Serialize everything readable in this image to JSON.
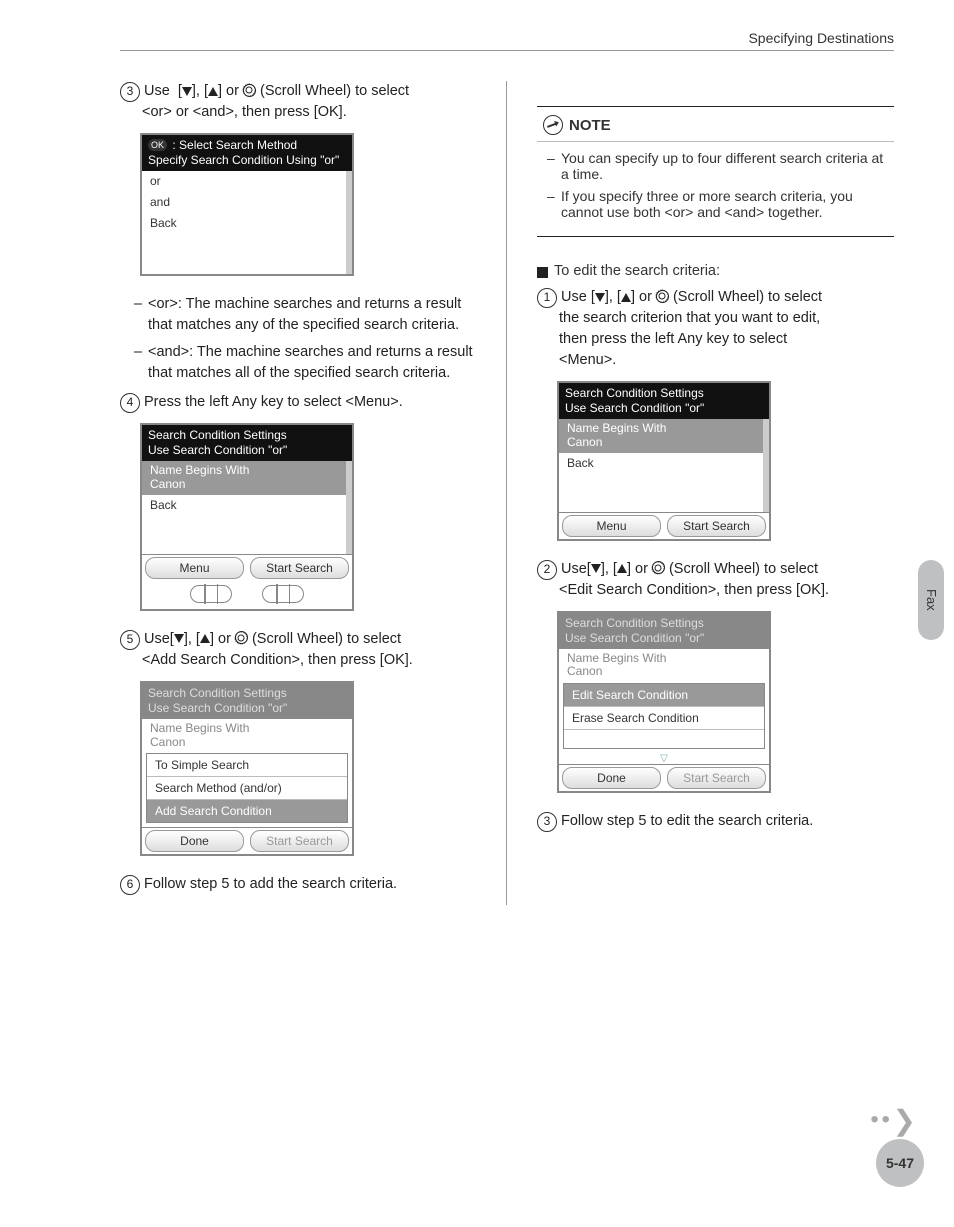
{
  "header": {
    "title": "Specifying Destinations"
  },
  "side_tab": "Fax",
  "page_number": "5-47",
  "left": {
    "step3": {
      "num": "3",
      "line1": "Use  [▼], [▲] or ◎ (Scroll Wheel) to select",
      "line2": "<or> or <and>, then press [OK]."
    },
    "device1": {
      "title_prefix": "OK",
      "title1": " : Select Search Method",
      "title2": "Specify Search Condition Using \"or\"",
      "rows": [
        "or",
        "and",
        "Back"
      ]
    },
    "dash": {
      "or": "<or>: The machine searches and returns a result that matches any of the specified search criteria.",
      "and": "<and>: The machine searches and returns a result that matches all of the specified search criteria."
    },
    "step4": {
      "num": "4",
      "text": "Press the left Any key to select <Menu>."
    },
    "device2": {
      "title1": "Search Condition Settings",
      "title2": "Use Search Condition \"or\"",
      "two_line": "Name Begins With\nCanon",
      "back": "Back",
      "btn_left": "Menu",
      "btn_right": "Start Search"
    },
    "step5": {
      "num": "5",
      "line1": "Use[▼], [▲] or ◎ (Scroll Wheel) to select",
      "line2": "<Add Search Condition>, then press [OK]."
    },
    "device3": {
      "title1": "Search Condition Settings",
      "title2": "Use Search Condition \"or\"",
      "two_line": "Name Begins With\nCanon",
      "rows": [
        "To Simple Search",
        "Search Method (and/or)",
        "Add Search Condition"
      ],
      "btn_left": "Done",
      "btn_right": "Start Search"
    },
    "step6": {
      "num": "6",
      "text": "Follow step 5 to add the search criteria."
    }
  },
  "right": {
    "note": {
      "label": "NOTE",
      "item1": "You can specify up to four different search criteria at a time.",
      "item2": "If you specify three or more search criteria, you cannot use both <or> and <and> together."
    },
    "subhead": "To edit the search criteria:",
    "step1": {
      "num": "1",
      "line1": "Use [▼], [▲] or ◎ (Scroll Wheel) to select",
      "line2": "the search criterion that you want to edit,",
      "line3": "then press the left Any key to select",
      "line4": "<Menu>."
    },
    "device1": {
      "title1": "Search Condition Settings",
      "title2": "Use Search Condition \"or\"",
      "two_line": "Name Begins With\nCanon",
      "back": "Back",
      "btn_left": "Menu",
      "btn_right": "Start Search"
    },
    "step2": {
      "num": "2",
      "line1": "Use[▼], [▲] or ◎ (Scroll Wheel) to select",
      "line2": "<Edit Search Condition>, then press [OK]."
    },
    "device2": {
      "title1": "Search Condition Settings",
      "title2": "Use Search Condition \"or\"",
      "two_line": "Name Begins With\nCanon",
      "rows": [
        "Edit Search Condition",
        "Erase Search Condition"
      ],
      "btn_left": "Done",
      "btn_right": "Start Search"
    },
    "step3": {
      "num": "3",
      "text": "Follow step 5 to edit the search criteria."
    }
  }
}
